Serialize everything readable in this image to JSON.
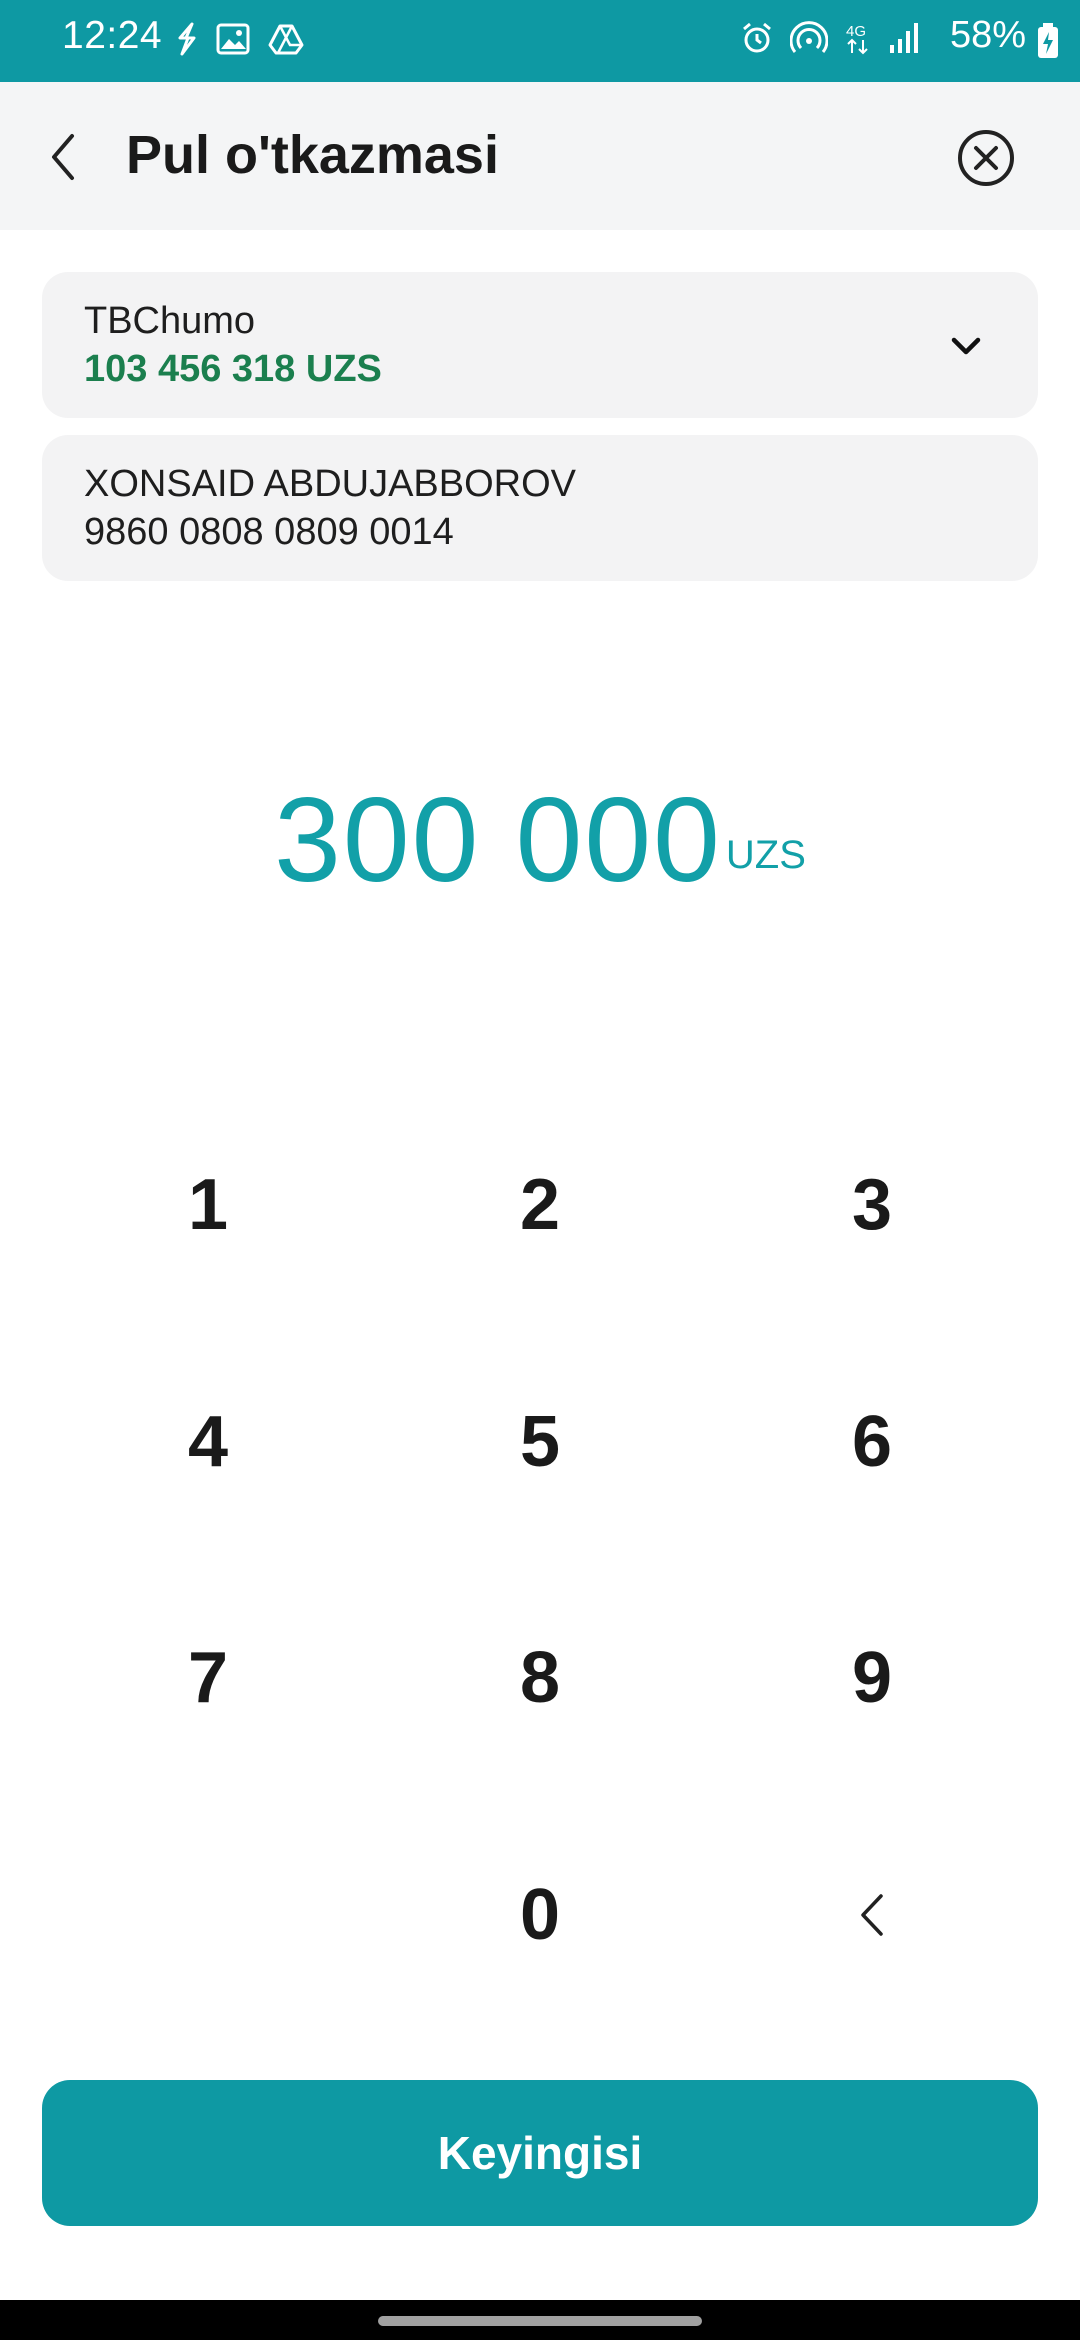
{
  "status_bar": {
    "time": "12:24",
    "battery": "58%",
    "left_icons": [
      "sync-icon",
      "image-icon",
      "drive-icon"
    ],
    "right_icons": [
      "alarm-icon",
      "hotspot-icon",
      "4g-icon",
      "signal-icon",
      "battery-charging-icon"
    ]
  },
  "header": {
    "title": "Pul o'tkazmasi"
  },
  "source_card": {
    "name": "TBChumo",
    "balance": "103 456 318 UZS"
  },
  "recipient_card": {
    "name": "XONSAID ABDUJABBOROV",
    "card_number": "9860 0808 0809 0014"
  },
  "amount": {
    "value": "300 000",
    "currency": "UZS"
  },
  "keypad": {
    "keys": [
      "1",
      "2",
      "3",
      "4",
      "5",
      "6",
      "7",
      "8",
      "9",
      "0"
    ]
  },
  "next_button": {
    "label": "Keyingisi"
  },
  "colors": {
    "accent": "#0e99a3",
    "balance": "#1b7f4e",
    "amount": "#12a0a8"
  }
}
